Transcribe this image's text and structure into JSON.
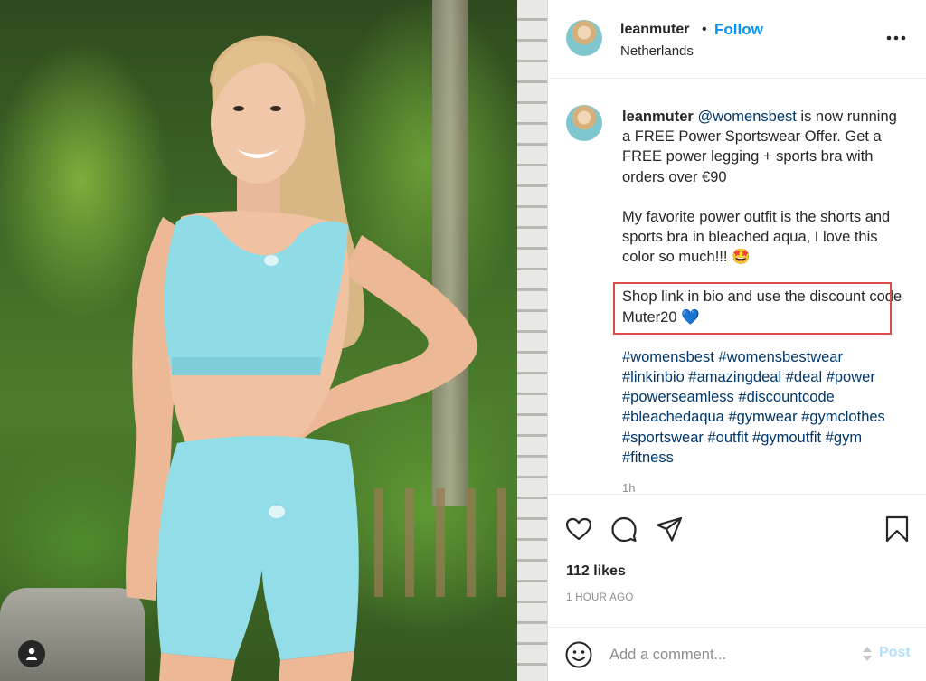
{
  "post": {
    "author": "leanmuter",
    "follow_label": "Follow",
    "separator": "•",
    "location": "Netherlands",
    "caption": {
      "mention": "@womensbest",
      "line1_rest": " is now running a FREE Power Sportswear Offer. Get a FREE power legging + sports bra with orders over €90",
      "para2": "My favorite power outfit is the shorts and sports bra in bleached aqua, I love this color so much!!! 🤩",
      "para3": "Shop link in bio and use the discount code Muter20 💙",
      "hashtags": [
        "#womensbest",
        "#womensbestwear",
        "#linkinbio",
        "#amazingdeal",
        "#deal",
        "#power",
        "#powerseamless",
        "#discountcode",
        "#bleachedaqua",
        "#gymwear",
        "#gymclothes",
        "#sportswear",
        "#outfit",
        "#gymoutfit",
        "#gym",
        "#fitness"
      ]
    },
    "relative_time_partial": "1h",
    "likes_text": "112 likes",
    "posted_ago": "1 HOUR AGO"
  },
  "comment": {
    "placeholder": "Add a comment...",
    "post_label": "Post"
  },
  "colors": {
    "accent_blue": "#0095f6",
    "hashtag_blue": "#00376b",
    "highlight_red": "#dd4a4a",
    "muted_gray": "#8e8e8e"
  },
  "icons": [
    "more-options-icon",
    "heart-icon",
    "comment-icon",
    "share-icon",
    "bookmark-icon",
    "emoji-icon",
    "user-tag-icon"
  ]
}
